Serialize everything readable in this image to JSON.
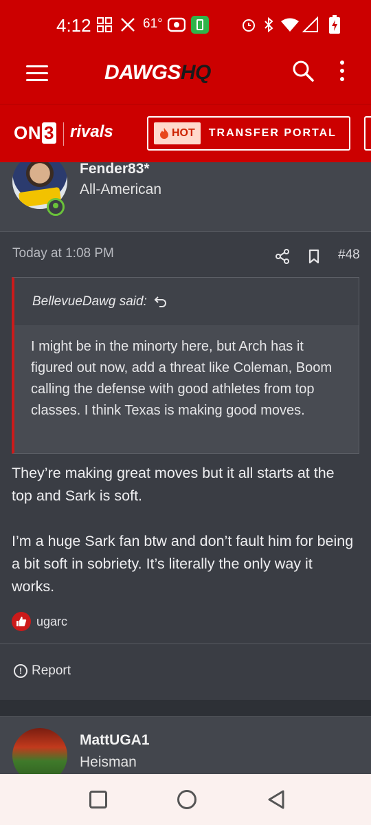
{
  "status_bar": {
    "time": "4:12",
    "temperature": "61°",
    "icons": [
      "grid-icon",
      "x-logo-icon",
      "record-icon",
      "battery-saver-icon",
      "alarm-icon",
      "bluetooth-icon",
      "wifi-icon",
      "signal-icon",
      "battery-charging-icon"
    ]
  },
  "header": {
    "brand_main": "DAWGS",
    "brand_hq": "HQ",
    "menu_icon": "hamburger-icon",
    "search_icon": "search-icon",
    "more_icon": "more-vertical-icon"
  },
  "partner_bar": {
    "on3_prefix": "ON",
    "on3_suffix": "3",
    "rivals": "rivals",
    "hot_badge": "HOT",
    "portal_label": "TRANSFER PORTAL"
  },
  "post": {
    "author": "Fender83*",
    "author_title": "All-American",
    "date": "Today at 1:08 PM",
    "number": "#48",
    "quote": {
      "author_line": "BellevueDawg said:",
      "text": "I might be in the minorty here, but Arch has it figured out now, add a threat like Coleman, Boom calling the defense with good athletes from top classes. I think Texas is making good moves."
    },
    "paragraphs": [
      "They’re making great moves but it all starts at the top and Sark is soft.",
      "I’m a huge Sark fan btw and don’t fault him for being a bit soft in sobriety. It’s literally the only way it works."
    ],
    "reaction_user": "ugarc",
    "report_label": "Report"
  },
  "next_post": {
    "author": "MattUGA1",
    "author_title": "Heisman"
  },
  "colors": {
    "brand_red": "#cc0000",
    "background": "#3a3d44",
    "card": "#43464d",
    "quote_accent": "#cc1a1a",
    "online_green": "#6ac23a"
  }
}
